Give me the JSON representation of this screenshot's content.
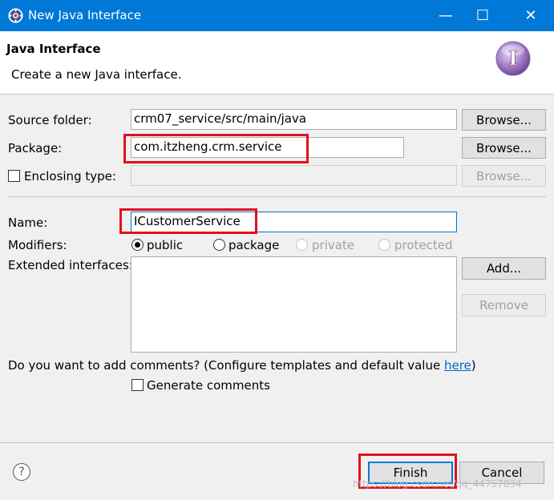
{
  "window": {
    "title": "New Java Interface",
    "icon": "eclipse-gear-icon",
    "controls": {
      "minimize": "—",
      "maximize": "☐",
      "close": "✕"
    }
  },
  "header": {
    "title": "Java Interface",
    "description": "Create a new Java interface.",
    "icon": "interface-I-icon"
  },
  "form": {
    "source_folder": {
      "label": "Source folder:",
      "value": "crm07_service/src/main/java",
      "browse": "Browse..."
    },
    "package": {
      "label": "Package:",
      "value": "com.itzheng.crm.service",
      "browse": "Browse..."
    },
    "enclosing_type": {
      "label": "Enclosing type:",
      "value": "",
      "browse": "Browse...",
      "checked": false
    },
    "name": {
      "label": "Name:",
      "value": "ICustomerService"
    },
    "modifiers": {
      "label": "Modifiers:",
      "options": [
        {
          "label": "public",
          "selected": true,
          "enabled": true
        },
        {
          "label": "package",
          "selected": false,
          "enabled": true
        },
        {
          "label": "private",
          "selected": false,
          "enabled": false
        },
        {
          "label": "protected",
          "selected": false,
          "enabled": false
        }
      ]
    },
    "extended_interfaces": {
      "label": "Extended interfaces:",
      "add": "Add...",
      "remove": "Remove"
    },
    "comments": {
      "question": "Do you want to add comments? (Configure templates and default value ",
      "link": "here",
      "close_paren": ")",
      "generate_label": "Generate comments",
      "generate_checked": false
    }
  },
  "footer": {
    "help_icon": "?",
    "finish": "Finish",
    "cancel": "Cancel",
    "watermark": "https://blog.csdn.net/qq_44757034"
  },
  "colors": {
    "titlebar": "#0078d7",
    "annotation_red": "#e3101d",
    "link": "#0066cc"
  }
}
